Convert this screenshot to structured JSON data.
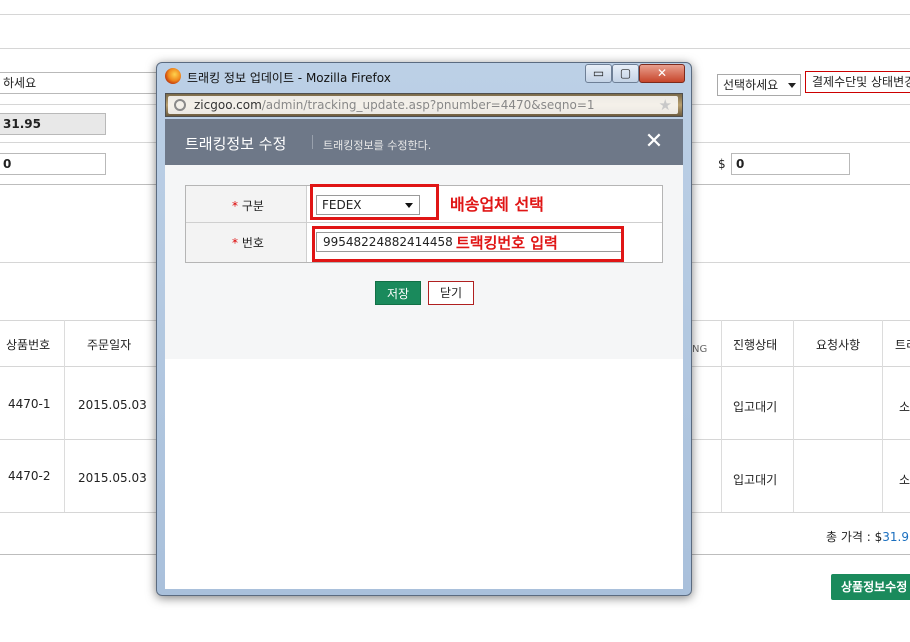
{
  "background": {
    "search_value": "하세요",
    "amount_gray": "31.95",
    "amount_zero_left": "0",
    "dollar_sign": "$",
    "amount_zero_right": "0",
    "select_label": "선택하세요",
    "status_change_button": "결제수단및 상태변경",
    "table": {
      "headers": [
        "상품번호",
        "주문일자",
        "NG",
        "진행상태",
        "요청사항",
        "트리"
      ],
      "rows": [
        {
          "product_no": "4470-1",
          "order_date": "2015.05.03",
          "status": "입고대기",
          "tail": "소"
        },
        {
          "product_no": "4470-2",
          "order_date": "2015.05.03",
          "status": "입고대기",
          "tail": "소"
        }
      ]
    },
    "total_label": "총 가격 : $",
    "total_value": "31.9",
    "product_update_button": "상품정보수정"
  },
  "window": {
    "title": "트래킹 정보 업데이트 - Mozilla Firefox",
    "url_domain": "zicgoo.com",
    "url_path": "/admin/tracking_update.asp?pnumber=4470&seqno=1",
    "controls": {
      "minimize": "▭",
      "maximize": "▢",
      "close": "✕"
    }
  },
  "dialog": {
    "title": "트래킹정보 수정",
    "subtitle": "트래킹정보를 수정한다.",
    "close": "✕",
    "fields": {
      "carrier_label": "구분",
      "carrier_value": "FEDEX",
      "number_label": "번호",
      "number_value": "99548224882414458"
    },
    "required_mark": "*",
    "annotations": {
      "carrier_note": "배송업체 선택",
      "number_note": "트랙킹번호 입력"
    },
    "buttons": {
      "save": "저장",
      "close": "닫기"
    }
  },
  "colors": {
    "accent_green": "#1a8a5c",
    "annotation_red": "#e01515",
    "header_gray": "#6e7888"
  }
}
